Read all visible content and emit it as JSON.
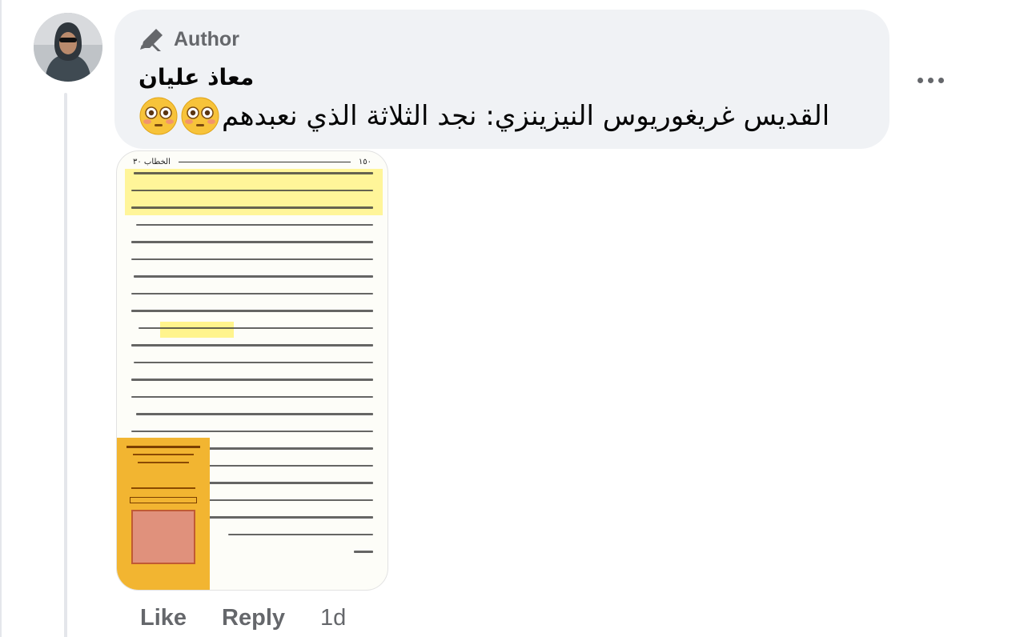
{
  "comment": {
    "author_badge": "Author",
    "author_name": "معاذ عليان",
    "text": "القديس غريغوريوس النيزينزي: نجد الثلاثة الذي نعبدهم",
    "emoji": [
      "flushed-face",
      "flushed-face"
    ]
  },
  "attachment": {
    "page_number": "١٥٠",
    "page_header": "الخطاب ٣٠",
    "highlight_color": "#fff27a",
    "cover_color": "#f2b531"
  },
  "actions": {
    "like_label": "Like",
    "reply_label": "Reply",
    "timestamp": "1d"
  },
  "colors": {
    "bubble": "#f0f2f5",
    "secondary_text": "#65676b",
    "primary_text": "#050505"
  }
}
